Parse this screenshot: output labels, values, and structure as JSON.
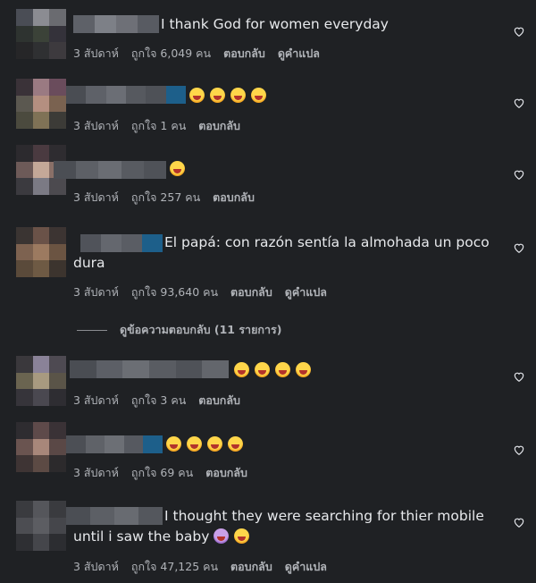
{
  "comments": [
    {
      "text": "I thank God for women everyday",
      "emoji": [],
      "time": "3 สัปดาห์",
      "likes": "ถูกใจ 6,049 คน",
      "reply": "ตอบกลับ",
      "translate": "ดูคำแปล"
    },
    {
      "text": "",
      "emoji": [
        "grin",
        "grin",
        "grin",
        "grin"
      ],
      "time": "3 สัปดาห์",
      "likes": "ถูกใจ 1 คน",
      "reply": "ตอบกลับ",
      "translate": ""
    },
    {
      "text": "",
      "emoji": [
        "grin"
      ],
      "time": "3 สัปดาห์",
      "likes": "ถูกใจ 257 คน",
      "reply": "ตอบกลับ",
      "translate": ""
    },
    {
      "text": "El papá: con razón sentía la almohada un poco dura",
      "emoji": [],
      "time": "3 สัปดาห์",
      "likes": "ถูกใจ 93,640 คน",
      "reply": "ตอบกลับ",
      "translate": "ดูคำแปล"
    },
    {
      "text": "",
      "emoji": [
        "grin",
        "grin",
        "grin",
        "grin"
      ],
      "time": "3 สัปดาห์",
      "likes": "ถูกใจ 3 คน",
      "reply": "ตอบกลับ",
      "translate": ""
    },
    {
      "text": "",
      "emoji": [
        "grin",
        "grin",
        "grin",
        "grin"
      ],
      "time": "3 สัปดาห์",
      "likes": "ถูกใจ 69 คน",
      "reply": "ตอบกลับ",
      "translate": ""
    },
    {
      "text": "I thought they were searching for thier mobile until i saw the baby",
      "emoji": [
        "cry",
        "grin"
      ],
      "time": "3 สัปดาห์",
      "likes": "ถูกใจ 47,125 คน",
      "reply": "ตอบกลับ",
      "translate": "ดูคำแปล"
    }
  ],
  "view_replies": "ดูข้อความตอบกลับ (11 รายการ)",
  "colors": {
    "background": "#1f2124",
    "text": "#e4e6eb",
    "meta": "#b0b3b8"
  }
}
